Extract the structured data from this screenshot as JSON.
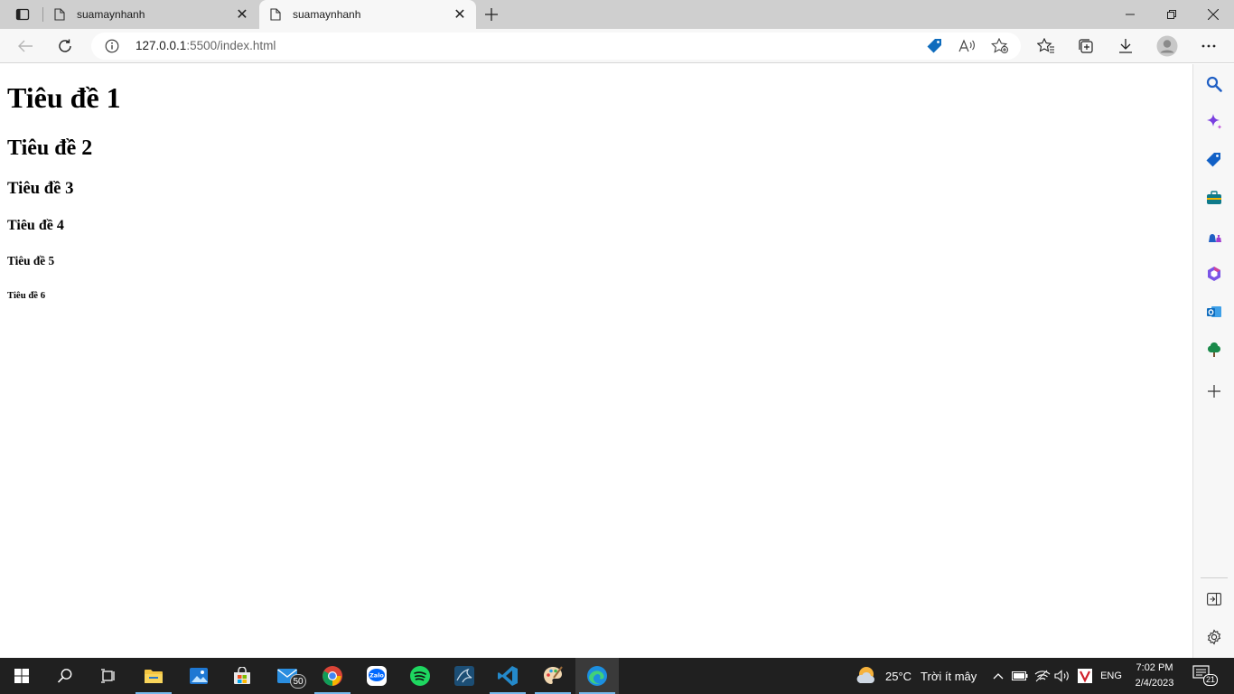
{
  "browser": {
    "tabs": [
      {
        "title": "suamaynhanh",
        "active": false
      },
      {
        "title": "suamaynhanh",
        "active": true
      }
    ],
    "address": {
      "host": "127.0.0.1",
      "rest": ":5500/index.html"
    }
  },
  "page": {
    "headings": [
      "Tiêu đề 1",
      "Tiêu đề 2",
      "Tiêu đề 3",
      "Tiêu đề 4",
      "Tiêu đề 5",
      "Tiêu đề 6"
    ]
  },
  "taskbar": {
    "mail_badge": "50",
    "weather": {
      "temp": "25°C",
      "desc": "Trời ít mây"
    },
    "language": "ENG",
    "clock": {
      "time": "7:02 PM",
      "date": "2/4/2023"
    },
    "notifications": "21"
  },
  "colors": {
    "tab_strip": "#cfcfcf",
    "toolbar": "#f7f7f7",
    "taskbar": "#202020",
    "accent": "#0078d4"
  }
}
